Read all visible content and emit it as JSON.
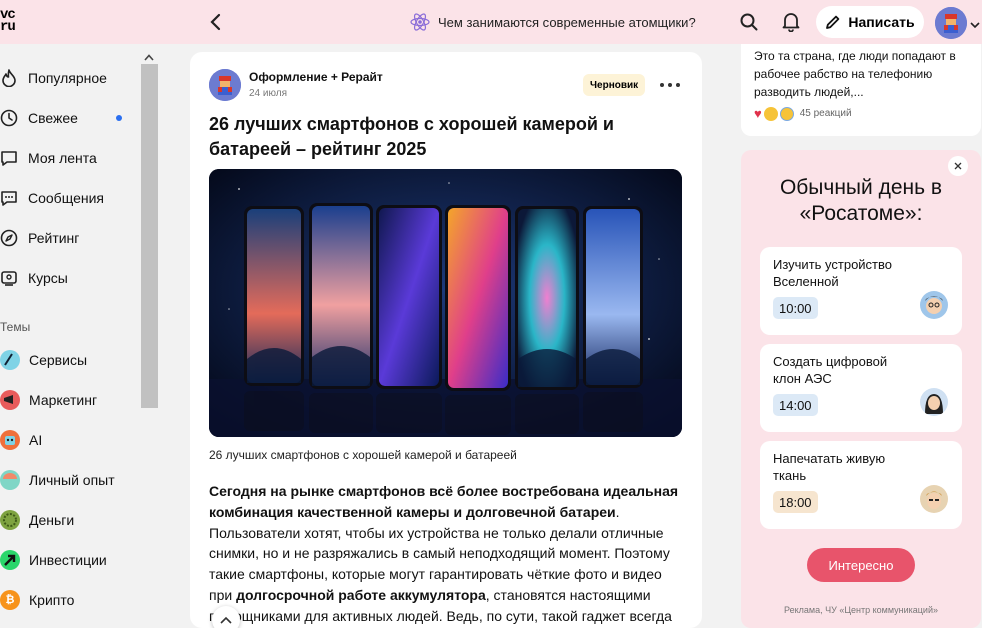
{
  "header": {
    "logo": "vc\nru",
    "promo_text": "Чем занимаются современные атомщики?",
    "write_label": "Написать"
  },
  "sidebar": {
    "items": [
      {
        "label": "Популярное",
        "icon": "flame-icon"
      },
      {
        "label": "Свежее",
        "icon": "clock-icon",
        "unread": true
      },
      {
        "label": "Моя лента",
        "icon": "feed-icon"
      },
      {
        "label": "Сообщения",
        "icon": "message-icon"
      },
      {
        "label": "Рейтинг",
        "icon": "compass-icon"
      },
      {
        "label": "Курсы",
        "icon": "courses-icon"
      }
    ],
    "topics_heading": "Темы",
    "topics": [
      {
        "label": "Сервисы",
        "color": "#7fd3e6"
      },
      {
        "label": "Маркетинг",
        "color": "#e85b5b"
      },
      {
        "label": "AI",
        "color": "#f0703a"
      },
      {
        "label": "Личный опыт",
        "color": "#7fd6c6"
      },
      {
        "label": "Деньги",
        "color": "#7ea340"
      },
      {
        "label": "Инвестиции",
        "color": "#2bd66b"
      },
      {
        "label": "Крипто",
        "color": "#f7931a"
      }
    ]
  },
  "article": {
    "author": "Оформление + Рерайт",
    "date": "24 июля",
    "badge": "Черновик",
    "title": "26 лучших смартфонов с хорошей камерой и батареей – рейтинг 2025",
    "caption": "26 лучших смартфонов с хорошей камерой и батареей",
    "p1_bold": "Сегодня на рынке смартфонов всё более востребована идеальная комбинация качественной камеры и долговечной батареи",
    "p1_rest": ". Пользователи хотят, чтобы их устройства не только делали отличные снимки, но и не разряжались в самый неподходящий момент. Поэтому такие смартфоны, которые могут гарантировать чёткие фото и видео при ",
    "p1_bold2": "долгосрочной работе аккумулятора",
    "p1_rest2": ", становятся настоящими помощниками для активных людей. Ведь, по сути, такой гаджет всегда"
  },
  "comment": {
    "text": "Это та страна, где люди попадают в рабочее рабство на телефонию разводить людей,...",
    "reactions": "45 реакций"
  },
  "ad": {
    "title": "Обычный день в «Росатоме»:",
    "tasks": [
      {
        "name": "Изучить устройство Вселенной",
        "time": "10:00"
      },
      {
        "name": "Создать цифровой клон АЭС",
        "time": "14:00"
      },
      {
        "name": "Напечатать живую ткань",
        "time": "18:00"
      }
    ],
    "button": "Интересно",
    "note": "Реклама, ЧУ «Центр коммуникаций»"
  },
  "colors": {
    "header_bg": "#fbe3e8",
    "ad_button": "#e8546b",
    "unread_dot": "#2a6ff0",
    "draft_badge": "#fdf3d7"
  }
}
